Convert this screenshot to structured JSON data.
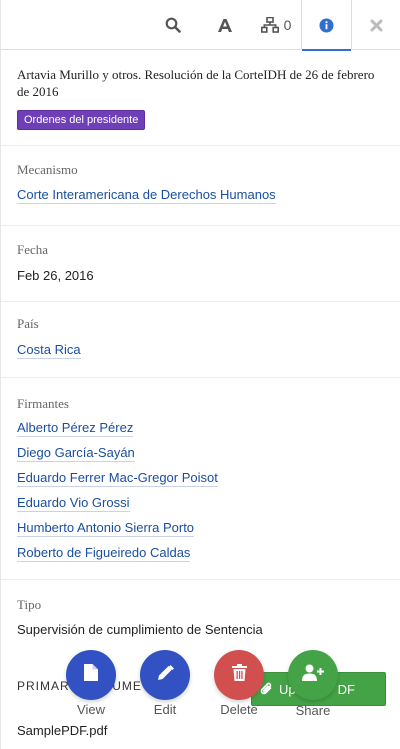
{
  "toolbar": {
    "search_icon": "search-icon",
    "font_icon": "font-icon",
    "connections_icon": "sitemap-icon",
    "connections_count": "0",
    "info_icon": "info-icon",
    "close_icon": "close-icon"
  },
  "document": {
    "title": "Artavia Murillo y otros. Resolución de la CorteIDH de 26 de febrero de 2016",
    "badge": "Ordenes del presidente"
  },
  "metadata": {
    "mecanismo": {
      "label": "Mecanismo",
      "value": "Corte Interamericana de Derechos Humanos"
    },
    "fecha": {
      "label": "Fecha",
      "value": "Feb 26, 2016"
    },
    "pais": {
      "label": "País",
      "value": "Costa Rica"
    },
    "firmantes": {
      "label": "Firmantes",
      "items": [
        "Alberto Pérez Pérez",
        "Diego García-Sayán",
        "Eduardo Ferrer Mac-Gregor Poisot",
        "Eduardo Vio Grossi",
        "Humberto Antonio Sierra Porto",
        "Roberto de Figueiredo Caldas"
      ]
    },
    "tipo": {
      "label": "Tipo",
      "value": "Supervisión de cumplimiento de Sentencia"
    }
  },
  "primary_document": {
    "label": "PRIMARY DOCUME",
    "filename": "SamplePDF.pdf",
    "upload_label_left": "Up",
    "upload_label_right": "DF"
  },
  "actions": {
    "view": "View",
    "edit": "Edit",
    "delete": "Delete",
    "share": "Share"
  },
  "colors": {
    "badge": "#6f3fb8",
    "link": "#1a4fa0",
    "fab_primary": "#3252c4",
    "fab_danger": "#d14f4f",
    "fab_success": "#45a347",
    "active_tab": "#2f6fd0"
  }
}
